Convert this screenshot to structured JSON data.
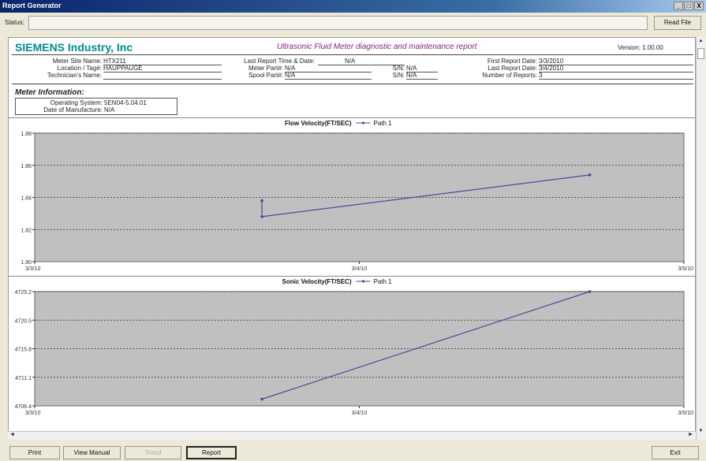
{
  "window": {
    "title": "Report Generator",
    "controls": [
      "_",
      "□",
      "X"
    ]
  },
  "status": {
    "label": "Status:",
    "value": "",
    "read_file": "Read File"
  },
  "report": {
    "company": "SIEMENS Industry, Inc",
    "title": "Ultrasonic Fluid Meter diagnostic and maintenance report",
    "version": "Version: 1.00.00",
    "fields": {
      "site_name_label": "Meter Site Name:",
      "site_name": "HTX211",
      "location_label": "Location / Tag#:",
      "location": "HAUPPAUGE",
      "technician_label": "Technician's Name:",
      "technician": "",
      "last_report_time_label": "Last Report Time & Date:",
      "last_report_time": "N/A",
      "meter_part_label": "Meter Part#:",
      "meter_part": "N/A",
      "meter_sn_label": "S/N:",
      "meter_sn": "N/A",
      "spool_part_label": "Spool Part#:",
      "spool_part": "N/A",
      "spool_sn_label": "S/N:",
      "spool_sn": "N/A",
      "first_report_label": "First Report Date:",
      "first_report": "3/3/2010",
      "last_report_label": "Last Report Date:",
      "last_report": "3/4/2010",
      "num_reports_label": "Number of Reports:",
      "num_reports": "3"
    },
    "meter_info": {
      "title": "Meter Information:",
      "os_label": "Operating System:",
      "os": "5EN04-5.04.01",
      "dom_label": "Date of Manufacture:",
      "dom": "N/A"
    }
  },
  "chart_data": [
    {
      "type": "line",
      "title": "Flow Velocity(FT/SEC)",
      "series": [
        {
          "name": "Path 1",
          "x": [
            0.7,
            0.7,
            1.71
          ],
          "y": [
            1.838,
            1.828,
            1.854
          ]
        }
      ],
      "x_ticks": [
        "3/3/10",
        "3/4/10",
        "3/5/10"
      ],
      "xlim": [
        0,
        2
      ],
      "ylim": [
        1.8,
        1.88
      ],
      "y_ticks": [
        "1.80",
        "1.82",
        "1.84",
        "1.86",
        "1.88"
      ],
      "grid": true,
      "colors": {
        "plot_bg": "#c0c0c0",
        "line": "#4a4a9c"
      }
    },
    {
      "type": "line",
      "title": "Sonic Velocity(FT/SEC)",
      "series": [
        {
          "name": "Path 1",
          "x": [
            0.7,
            1.71
          ],
          "y": [
            4707.5,
            4725.2
          ]
        }
      ],
      "x_ticks": [
        "3/3/10",
        "3/4/10",
        "3/5/10"
      ],
      "xlim": [
        0,
        2
      ],
      "ylim": [
        4706.4,
        4725.2
      ],
      "y_ticks": [
        "4706.4",
        "4711.1",
        "4715.8",
        "4720.5",
        "4725.2"
      ],
      "grid": true,
      "colors": {
        "plot_bg": "#c0c0c0",
        "line": "#4a4a9c"
      }
    }
  ],
  "buttons": {
    "print": "Print",
    "view_manual": "View Manual",
    "trend": "Trend",
    "report": "Report",
    "exit": "Exit"
  }
}
